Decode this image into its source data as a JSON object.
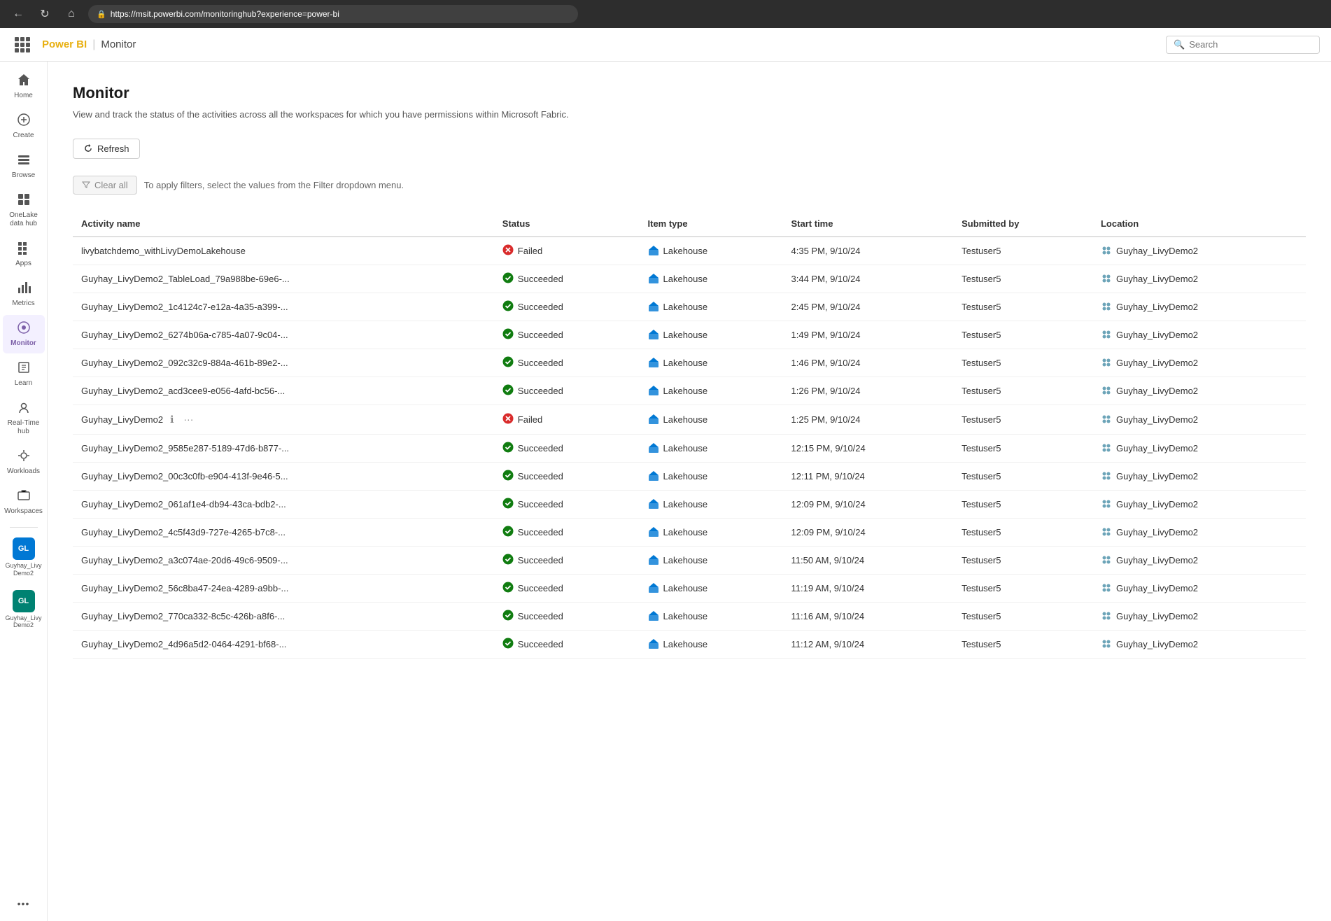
{
  "browser": {
    "url_prefix": "https://",
    "url_domain": "msit.powerbi.com",
    "url_path": "/monitoringhub?experience=power-bi"
  },
  "header": {
    "brand_name": "Power BI",
    "breadcrumb_separator": "|",
    "breadcrumb_page": "Monitor",
    "search_placeholder": "Search"
  },
  "sidebar": {
    "items": [
      {
        "id": "home",
        "label": "Home",
        "icon": "🏠"
      },
      {
        "id": "create",
        "label": "Create",
        "icon": "➕"
      },
      {
        "id": "browse",
        "label": "Browse",
        "icon": "📁"
      },
      {
        "id": "onelake",
        "label": "OneLake data hub",
        "icon": "⊞"
      },
      {
        "id": "apps",
        "label": "Apps",
        "icon": "⚏"
      },
      {
        "id": "metrics",
        "label": "Metrics",
        "icon": "⊞"
      },
      {
        "id": "monitor",
        "label": "Monitor",
        "icon": "◉",
        "active": true
      },
      {
        "id": "learn",
        "label": "Learn",
        "icon": "📖"
      },
      {
        "id": "realtime",
        "label": "Real-Time hub",
        "icon": "👤"
      },
      {
        "id": "workloads",
        "label": "Workloads",
        "icon": "⚙"
      },
      {
        "id": "workspaces",
        "label": "Workspaces",
        "icon": "💼"
      }
    ],
    "workspace_items": [
      {
        "id": "guyhay-livy-demo2-nav",
        "label": "Guyhay_Livy Demo2",
        "initials": "GL"
      },
      {
        "id": "guyhay-livy-demo2b-nav",
        "label": "Guyhay_Livy Demo2",
        "initials": "GL",
        "teal": true
      }
    ],
    "more_label": "..."
  },
  "page": {
    "title": "Monitor",
    "subtitle": "View and track the status of the activities across all the workspaces for which you have permissions within Microsoft Fabric.",
    "refresh_label": "Refresh",
    "clear_all_label": "Clear all",
    "filter_hint": "To apply filters, select the values from the Filter dropdown menu."
  },
  "table": {
    "columns": [
      "Activity name",
      "Status",
      "Item type",
      "Start time",
      "Submitted by",
      "Location"
    ],
    "rows": [
      {
        "activity_name": "livybatchdemo_withLivyDemoLakehouse",
        "status": "Failed",
        "status_type": "failed",
        "item_type": "Lakehouse",
        "start_time": "4:35 PM, 9/10/24",
        "submitted_by": "Testuser5",
        "location": "Guyhay_LivyDemo2",
        "has_actions": false
      },
      {
        "activity_name": "Guyhay_LivyDemo2_TableLoad_79a988be-69e6-...",
        "status": "Succeeded",
        "status_type": "succeeded",
        "item_type": "Lakehouse",
        "start_time": "3:44 PM, 9/10/24",
        "submitted_by": "Testuser5",
        "location": "Guyhay_LivyDemo2",
        "has_actions": false
      },
      {
        "activity_name": "Guyhay_LivyDemo2_1c4124c7-e12a-4a35-a399-...",
        "status": "Succeeded",
        "status_type": "succeeded",
        "item_type": "Lakehouse",
        "start_time": "2:45 PM, 9/10/24",
        "submitted_by": "Testuser5",
        "location": "Guyhay_LivyDemo2",
        "has_actions": false
      },
      {
        "activity_name": "Guyhay_LivyDemo2_6274b06a-c785-4a07-9c04-...",
        "status": "Succeeded",
        "status_type": "succeeded",
        "item_type": "Lakehouse",
        "start_time": "1:49 PM, 9/10/24",
        "submitted_by": "Testuser5",
        "location": "Guyhay_LivyDemo2",
        "has_actions": false
      },
      {
        "activity_name": "Guyhay_LivyDemo2_092c32c9-884a-461b-89e2-...",
        "status": "Succeeded",
        "status_type": "succeeded",
        "item_type": "Lakehouse",
        "start_time": "1:46 PM, 9/10/24",
        "submitted_by": "Testuser5",
        "location": "Guyhay_LivyDemo2",
        "has_actions": false
      },
      {
        "activity_name": "Guyhay_LivyDemo2_acd3cee9-e056-4afd-bc56-...",
        "status": "Succeeded",
        "status_type": "succeeded",
        "item_type": "Lakehouse",
        "start_time": "1:26 PM, 9/10/24",
        "submitted_by": "Testuser5",
        "location": "Guyhay_LivyDemo2",
        "has_actions": false
      },
      {
        "activity_name": "Guyhay_LivyDemo2",
        "status": "Failed",
        "status_type": "failed",
        "item_type": "Lakehouse",
        "start_time": "1:25 PM, 9/10/24",
        "submitted_by": "Testuser5",
        "location": "Guyhay_LivyDemo2",
        "has_actions": true
      },
      {
        "activity_name": "Guyhay_LivyDemo2_9585e287-5189-47d6-b877-...",
        "status": "Succeeded",
        "status_type": "succeeded",
        "item_type": "Lakehouse",
        "start_time": "12:15 PM, 9/10/24",
        "submitted_by": "Testuser5",
        "location": "Guyhay_LivyDemo2",
        "has_actions": false
      },
      {
        "activity_name": "Guyhay_LivyDemo2_00c3c0fb-e904-413f-9e46-5...",
        "status": "Succeeded",
        "status_type": "succeeded",
        "item_type": "Lakehouse",
        "start_time": "12:11 PM, 9/10/24",
        "submitted_by": "Testuser5",
        "location": "Guyhay_LivyDemo2",
        "has_actions": false
      },
      {
        "activity_name": "Guyhay_LivyDemo2_061af1e4-db94-43ca-bdb2-...",
        "status": "Succeeded",
        "status_type": "succeeded",
        "item_type": "Lakehouse",
        "start_time": "12:09 PM, 9/10/24",
        "submitted_by": "Testuser5",
        "location": "Guyhay_LivyDemo2",
        "has_actions": false
      },
      {
        "activity_name": "Guyhay_LivyDemo2_4c5f43d9-727e-4265-b7c8-...",
        "status": "Succeeded",
        "status_type": "succeeded",
        "item_type": "Lakehouse",
        "start_time": "12:09 PM, 9/10/24",
        "submitted_by": "Testuser5",
        "location": "Guyhay_LivyDemo2",
        "has_actions": false
      },
      {
        "activity_name": "Guyhay_LivyDemo2_a3c074ae-20d6-49c6-9509-...",
        "status": "Succeeded",
        "status_type": "succeeded",
        "item_type": "Lakehouse",
        "start_time": "11:50 AM, 9/10/24",
        "submitted_by": "Testuser5",
        "location": "Guyhay_LivyDemo2",
        "has_actions": false
      },
      {
        "activity_name": "Guyhay_LivyDemo2_56c8ba47-24ea-4289-a9bb-...",
        "status": "Succeeded",
        "status_type": "succeeded",
        "item_type": "Lakehouse",
        "start_time": "11:19 AM, 9/10/24",
        "submitted_by": "Testuser5",
        "location": "Guyhay_LivyDemo2",
        "has_actions": false
      },
      {
        "activity_name": "Guyhay_LivyDemo2_770ca332-8c5c-426b-a8f6-...",
        "status": "Succeeded",
        "status_type": "succeeded",
        "item_type": "Lakehouse",
        "start_time": "11:16 AM, 9/10/24",
        "submitted_by": "Testuser5",
        "location": "Guyhay_LivyDemo2",
        "has_actions": false
      },
      {
        "activity_name": "Guyhay_LivyDemo2_4d96a5d2-0464-4291-bf68-...",
        "status": "Succeeded",
        "status_type": "succeeded",
        "item_type": "Lakehouse",
        "start_time": "11:12 AM, 9/10/24",
        "submitted_by": "Testuser5",
        "location": "Guyhay_LivyDemo2",
        "has_actions": false
      }
    ]
  }
}
